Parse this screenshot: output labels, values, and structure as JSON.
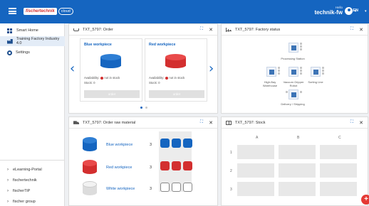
{
  "header": {
    "brand": "fischertechnik",
    "cloud": "cloud",
    "hello": "Hello",
    "username": "technik-fw",
    "caret": "▾",
    "language": "EN",
    "lang_caret": "▾"
  },
  "sidebar": {
    "items": [
      {
        "label": "Smart Home",
        "icon": "grid-icon"
      },
      {
        "label": "Training Factory Industry 4.0",
        "icon": "factory-icon"
      },
      {
        "label": "Settings",
        "icon": "gear-icon"
      }
    ],
    "links": [
      {
        "label": "eLearning-Portal"
      },
      {
        "label": "fischertechnik"
      },
      {
        "label": "fischerTiP"
      },
      {
        "label": "fischer group"
      }
    ]
  },
  "order": {
    "title": "TXT_5797: Order",
    "expand": "⛶",
    "close": "✕",
    "cards": [
      {
        "title": "Blue workpiece",
        "availability_label": "Availability:",
        "availability_value": "not in stock",
        "stock": "Stock: 0",
        "button": "order"
      },
      {
        "title": "Red workpiece",
        "availability_label": "Availability:",
        "availability_value": "not in stock",
        "stock": "Stock: 0",
        "button": "order"
      }
    ],
    "prev": "‹",
    "next": "›"
  },
  "factory": {
    "title": "TXT_5797: Factory status",
    "expand": "⛶",
    "close": "✕",
    "stations": [
      {
        "label": "Processing Station",
        "icon": "processing-station-icon"
      },
      {
        "label": "High-Bay Warehouse",
        "icon": "warehouse-icon"
      },
      {
        "label": "Vacuum Gripper Robot",
        "icon": "gripper-icon"
      },
      {
        "label": "Sorting Line",
        "icon": "sorting-icon"
      },
      {
        "label": "Delivery / Shipping",
        "icon": "truck-icon"
      }
    ]
  },
  "raw": {
    "title": "TXT_5797: Order raw material",
    "expand": "⛶",
    "close": "✕",
    "rows": [
      {
        "name": "Blue workpiece",
        "qty": "3",
        "color": "#1565c0"
      },
      {
        "name": "Red workpiece",
        "qty": "3",
        "color": "#d32f2f"
      },
      {
        "name": "White workpiece",
        "qty": "3",
        "color": "#ffffff"
      }
    ]
  },
  "stock": {
    "title": "TXT_5797: Stock",
    "expand": "⛶",
    "close": "✕",
    "columns": [
      "A",
      "B",
      "C"
    ],
    "rows": [
      "1",
      "2",
      "3"
    ]
  },
  "fab": {
    "label": "+"
  },
  "colors": {
    "primary": "#1565c0",
    "danger": "#d32f2f",
    "background": "#eef0f3"
  }
}
